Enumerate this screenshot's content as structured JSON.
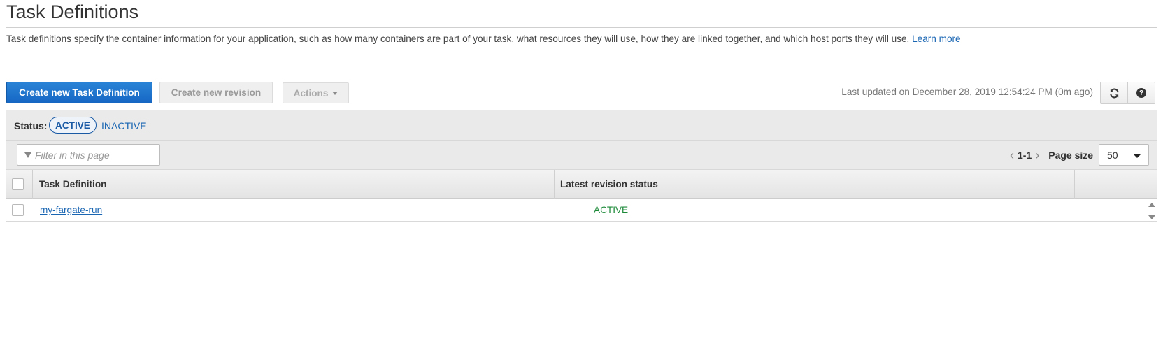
{
  "page": {
    "title": "Task Definitions",
    "description": "Task definitions specify the container information for your application, such as how many containers are part of your task, what resources they will use, how they are linked together, and which host ports they will use.",
    "learn_more": "Learn more"
  },
  "toolbar": {
    "create_label": "Create new Task Definition",
    "revision_label": "Create new revision",
    "actions_label": "Actions",
    "last_updated": "Last updated on December 28, 2019 12:54:24 PM (0m ago)",
    "refresh_icon": "refresh-icon",
    "help_icon": "help-icon"
  },
  "status_filter": {
    "label": "Status:",
    "active": "ACTIVE",
    "inactive": "INACTIVE"
  },
  "filter": {
    "placeholder": "Filter in this page"
  },
  "pager": {
    "range": "1-1",
    "page_size_label": "Page size",
    "page_size": "50"
  },
  "table": {
    "columns": [
      "Task Definition",
      "Latest revision status"
    ],
    "rows": [
      {
        "name": "my-fargate-run",
        "status": "ACTIVE"
      }
    ]
  },
  "colors": {
    "primary": "#1667c4",
    "link": "#1a66b3",
    "active_status": "#1d8a3a"
  }
}
